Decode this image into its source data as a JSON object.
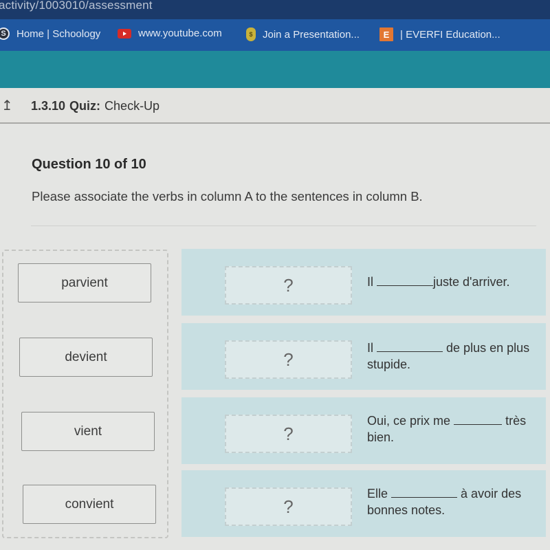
{
  "browser": {
    "url": "activity/1003010/assessment",
    "bookmarks": [
      {
        "icon": "schoology-icon",
        "glyph": "S",
        "label": "Home | Schoology"
      },
      {
        "icon": "youtube-icon",
        "glyph": "",
        "label": "www.youtube.com"
      },
      {
        "icon": "money-bag-icon",
        "glyph": "$",
        "label": "Join a Presentation..."
      },
      {
        "icon": "everfi-icon",
        "glyph": "E",
        "label": "| EVERFI Education..."
      }
    ],
    "colors": {
      "urlbar": "#1b3a6a",
      "bookmarks_bar": "#1f57a0",
      "teal_band": "#1f8a9a"
    }
  },
  "quiz_header": {
    "back_icon": "↥",
    "number": "1.3.10",
    "type": "Quiz:",
    "name": "Check-Up"
  },
  "question": {
    "title": "Question 10 of 10",
    "prompt": "Please associate the verbs in column A to the sentences in column B."
  },
  "column_a": {
    "verbs": [
      "parvient",
      "devient",
      "vient",
      "convient"
    ]
  },
  "column_b": {
    "rows": [
      {
        "placeholder": "?",
        "before": "Il",
        "after": "juste d'arriver."
      },
      {
        "placeholder": "?",
        "before": "Il",
        "after": "de plus en plus stupide."
      },
      {
        "placeholder": "?",
        "before": "Oui, ce prix me",
        "after": "très bien."
      },
      {
        "placeholder": "?",
        "before": "Elle",
        "after": "à avoir des bonnes notes."
      }
    ],
    "colors": {
      "row_bg": "#c8dfe2",
      "drop_zone_bg": "#dde9ea"
    }
  }
}
